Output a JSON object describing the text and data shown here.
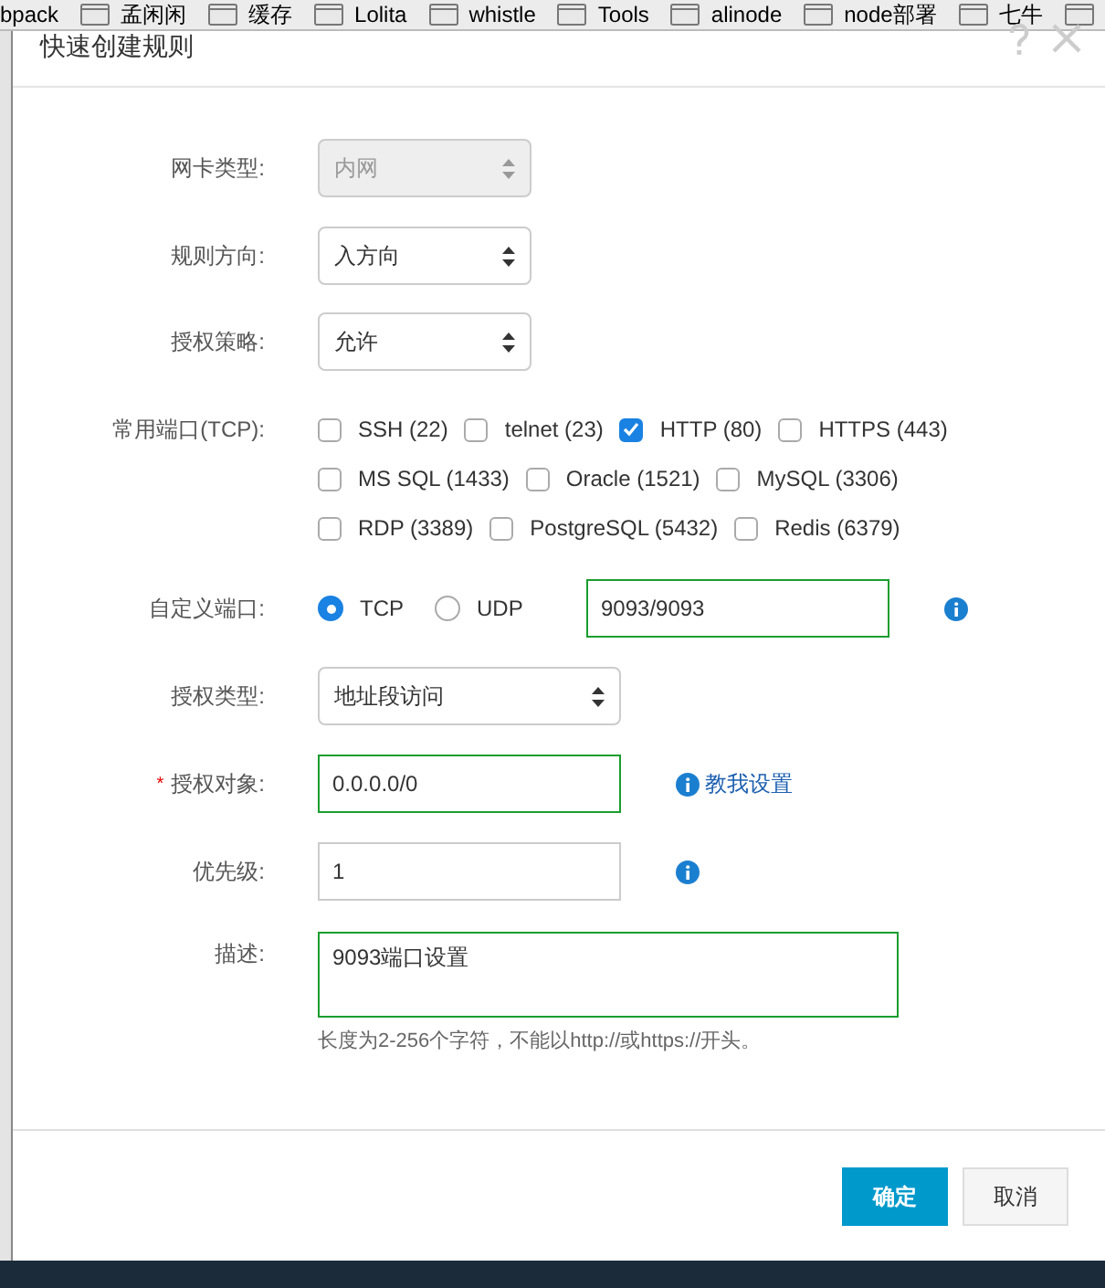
{
  "bookmarks": [
    "bpack",
    "孟闲闲",
    "缓存",
    "Lolita",
    "whistle",
    "Tools",
    "alinode",
    "node部署",
    "七牛"
  ],
  "dialog": {
    "title": "快速创建规则",
    "nic_type": {
      "label": "网卡类型:",
      "value": "内网",
      "disabled": true
    },
    "direction": {
      "label": "规则方向:",
      "value": "入方向",
      "disabled": false
    },
    "policy": {
      "label": "授权策略:",
      "value": "允许",
      "disabled": false
    },
    "common_ports": {
      "label": "常用端口(TCP):",
      "rows": [
        [
          {
            "label": "SSH (22)",
            "checked": false
          },
          {
            "label": "telnet (23)",
            "checked": false
          },
          {
            "label": "HTTP (80)",
            "checked": true
          },
          {
            "label": "HTTPS (443)",
            "checked": false
          }
        ],
        [
          {
            "label": "MS SQL (1433)",
            "checked": false
          },
          {
            "label": "Oracle (1521)",
            "checked": false
          },
          {
            "label": "MySQL (3306)",
            "checked": false
          }
        ],
        [
          {
            "label": "RDP (3389)",
            "checked": false
          },
          {
            "label": "PostgreSQL (5432)",
            "checked": false
          },
          {
            "label": "Redis (6379)",
            "checked": false
          }
        ]
      ]
    },
    "custom_port": {
      "label": "自定义端口:",
      "protocols": [
        {
          "label": "TCP",
          "selected": true
        },
        {
          "label": "UDP",
          "selected": false
        }
      ],
      "value": "9093/9093"
    },
    "auth_type": {
      "label": "授权类型:",
      "value": "地址段访问",
      "disabled": false
    },
    "auth_object": {
      "label": "授权对象:",
      "required": true,
      "required_mark": "*",
      "value": "0.0.0.0/0",
      "help_link": "教我设置"
    },
    "priority": {
      "label": "优先级:",
      "value": "1"
    },
    "description": {
      "label": "描述:",
      "value": "9093端口设置",
      "hint": "长度为2-256个字符，不能以http://或https://开头。"
    },
    "buttons": [
      {
        "label": "确定",
        "kind": "primary"
      },
      {
        "label": "取消",
        "kind": "secondary"
      }
    ]
  }
}
